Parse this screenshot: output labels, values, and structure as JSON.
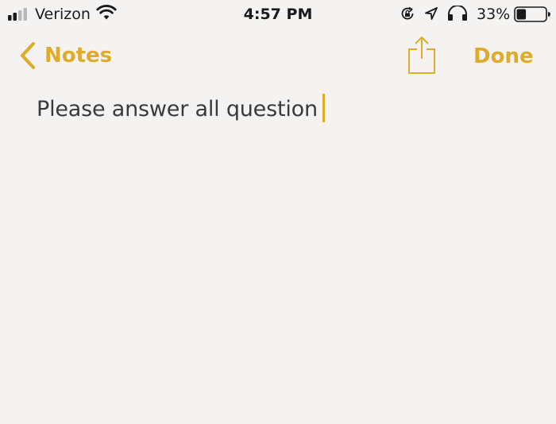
{
  "status_bar": {
    "carrier": "Verizon",
    "time": "4:57 PM",
    "battery_percent": "33%",
    "battery_level": 0.33,
    "signal_bars": 2,
    "icons": [
      "signal-icon",
      "wifi-icon",
      "rotation-lock-icon",
      "location-icon",
      "headphones-icon",
      "battery-icon"
    ]
  },
  "nav": {
    "back_label": "Notes",
    "done_label": "Done",
    "share_icon": "share-icon",
    "back_icon": "chevron-left-icon"
  },
  "note": {
    "text": "Please answer all question"
  },
  "colors": {
    "accent": "#e0ab2a",
    "background": "#f4f3f2",
    "text": "#3a3a3a"
  }
}
